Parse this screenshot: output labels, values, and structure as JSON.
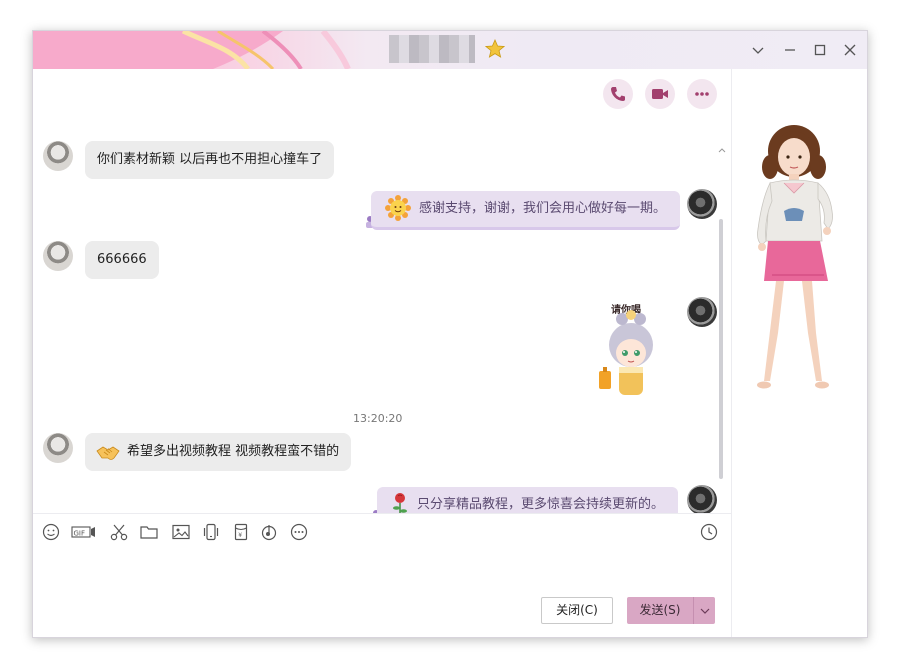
{
  "window": {
    "title_name": "",
    "controls": [
      "chevron-down-icon",
      "minimize-icon",
      "maximize-icon",
      "close-icon"
    ]
  },
  "top_actions": [
    "phone-icon",
    "video-icon",
    "more-icon"
  ],
  "messages": [
    {
      "side": "left",
      "text": "你们素材新颖 以后再也不用担心撞车了"
    },
    {
      "side": "right",
      "icon": "sun-emoji-icon",
      "text": "感谢支持，谢谢，我们会用心做好每一期。"
    },
    {
      "side": "left",
      "text": "666666"
    },
    {
      "side": "right",
      "sticker": "drink-sticker",
      "caption": "请你喝"
    },
    {
      "side": "left",
      "icon": "handshake-emoji-icon",
      "text": "希望多出视频教程 视频教程蛮不错的"
    },
    {
      "side": "right",
      "icon": "rose-emoji-icon",
      "text": "只分享精品教程，更多惊喜会持续更新的。"
    }
  ],
  "timestamp": "13:20:20",
  "toolbar": [
    "emoji-icon",
    "gif-icon",
    "scissors-icon",
    "folder-icon",
    "image-icon",
    "shake-icon",
    "red-packet-icon",
    "music-icon",
    "more-icon",
    "history-clock-icon"
  ],
  "buttons": {
    "close_label": "关闭(C)",
    "send_label": "发送(S)"
  },
  "colors": {
    "accent": "#d9a7c4",
    "bubble_left": "#ececec",
    "bubble_right": "#e8dff0"
  }
}
